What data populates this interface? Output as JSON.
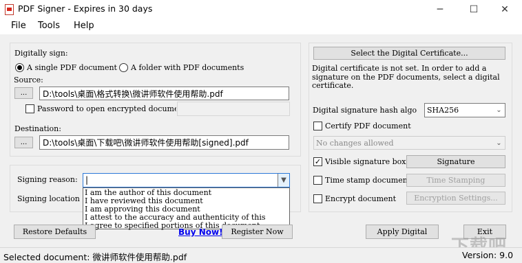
{
  "window": {
    "title": "PDF Signer - Expires in 30 days",
    "minimize": "─",
    "maximize": "☐",
    "close": "✕"
  },
  "menu": [
    "File",
    "Tools",
    "Help"
  ],
  "sign": {
    "group_label": "Digitally sign:",
    "radio_single": "A single PDF document",
    "radio_folder": "A folder with PDF documents",
    "source_label": "Source:",
    "browse": "...",
    "source_value": "D:\\tools\\桌面\\格式转换\\微讲师软件使用帮助.pdf",
    "password_label": "Password to open encrypted documen",
    "destination_label": "Destination:",
    "destination_value": "D:\\tools\\桌面\\下载吧\\微讲师软件使用帮助[signed].pdf"
  },
  "reason": {
    "label": "Signing reason:",
    "value": "|",
    "location_label": "Signing location",
    "options": [
      "I am the author of this document",
      "I have reviewed this document",
      "I am approving this document",
      "I attest to the accuracy and authenticity of this",
      "I agree to specified portions of this document"
    ]
  },
  "cert": {
    "select_button": "Select the Digital Certificate...",
    "info": "Digital certificate is not set. In order to add a signature on the PDF documents, select a digital certificate.",
    "hash_label": "Digital signature hash algo",
    "hash_value": "SHA256",
    "certify_label": "Certify PDF document",
    "certify_value": "No changes allowed",
    "visible_label": "Visible signature box",
    "signature_button": "Signature",
    "timestamp_label": "Time stamp document",
    "timestamp_button": "Time Stamping",
    "encrypt_label": "Encrypt document",
    "encrypt_button": "Encryption Settings..."
  },
  "bottom": {
    "restore": "Restore Defaults",
    "buy": "Buy Now!",
    "register": "Register Now",
    "apply": "Apply Digital",
    "exit": "Exit"
  },
  "status": {
    "selected": "Selected document: 微讲师软件使用帮助.pdf",
    "version": "Version: 9.0"
  },
  "watermark": "下载吧"
}
